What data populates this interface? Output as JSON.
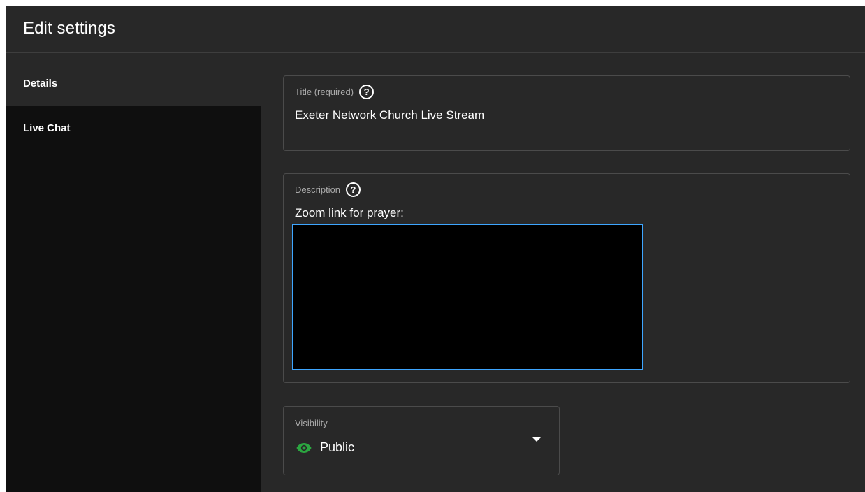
{
  "header": {
    "title": "Edit settings"
  },
  "sidebar": {
    "items": [
      {
        "label": "Details",
        "active": true
      },
      {
        "label": "Live Chat",
        "active": false
      }
    ]
  },
  "form": {
    "title": {
      "label": "Title (required)",
      "value": "Exeter Network Church Live Stream",
      "help_icon": "help-circle-icon"
    },
    "description": {
      "label": "Description",
      "value": "Zoom link for prayer:",
      "help_icon": "help-circle-icon"
    },
    "visibility": {
      "label": "Visibility",
      "value": "Public",
      "icon": "eye-icon",
      "icon_color": "#2ba640"
    }
  },
  "colors": {
    "background": "#282828",
    "sidebar": "#0f0f0f",
    "focus_border": "#3ea6ff"
  }
}
